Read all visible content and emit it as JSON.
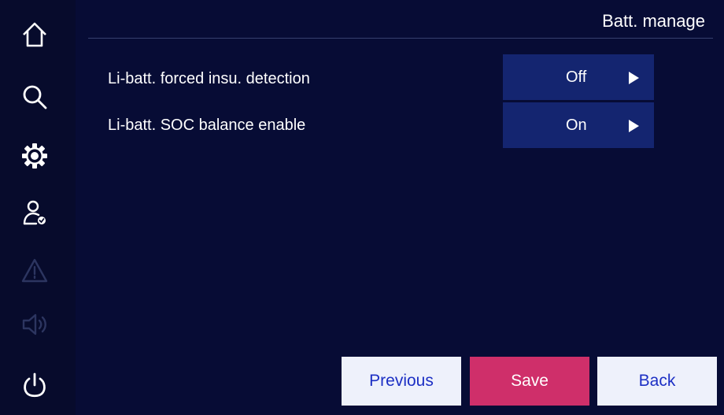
{
  "header": {
    "title": "Batt. manage"
  },
  "sidebar": {
    "items": [
      {
        "icon": "home-icon"
      },
      {
        "icon": "search-icon"
      },
      {
        "icon": "gear-icon"
      },
      {
        "icon": "user-check-icon"
      },
      {
        "icon": "warning-icon",
        "state": "disabled"
      },
      {
        "icon": "speaker-icon",
        "state": "disabled"
      },
      {
        "icon": "power-icon"
      }
    ]
  },
  "settings": [
    {
      "label": "Li-batt. forced insu. detection",
      "value": "Off"
    },
    {
      "label": "Li-batt. SOC balance enable",
      "value": "On"
    }
  ],
  "buttons": {
    "previous": "Previous",
    "save": "Save",
    "back": "Back"
  },
  "colors": {
    "background": "#070c35",
    "value_box": "#142570",
    "save_button": "#cf2f6a",
    "light_button": "#eef1fb",
    "light_button_text": "#1c2fc4",
    "disabled_icon": "#2c3560"
  }
}
